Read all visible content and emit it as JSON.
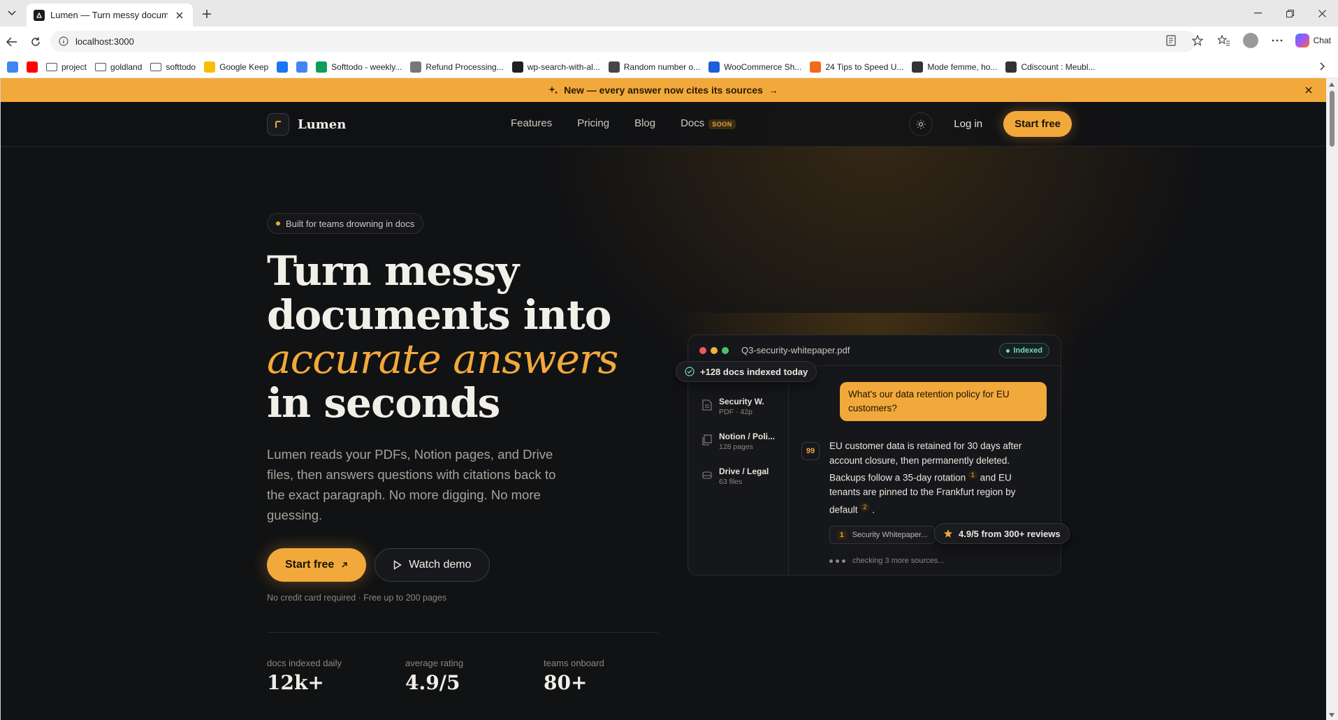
{
  "browser": {
    "tab_title": "Lumen — Turn messy documents into accurate answers",
    "url": "localhost:3000",
    "copilot_label": "Chat",
    "bookmarks": [
      {
        "label": "",
        "icon": "google-icon",
        "color": "#4285f4"
      },
      {
        "label": "",
        "icon": "youtube-icon",
        "color": "#ff0000"
      },
      {
        "label": "project",
        "icon": "folder-icon"
      },
      {
        "label": "goldland",
        "icon": "folder-icon"
      },
      {
        "label": "softtodo",
        "icon": "folder-icon"
      },
      {
        "label": "Google Keep",
        "icon": "keep-icon",
        "color": "#fbbc04"
      },
      {
        "label": "",
        "icon": "facebook-icon",
        "color": "#1877f2"
      },
      {
        "label": "",
        "icon": "translate-icon",
        "color": "#4285f4"
      },
      {
        "label": "Softtodo - weekly...",
        "icon": "sheets-icon",
        "color": "#0f9d58"
      },
      {
        "label": "Refund Processing...",
        "icon": "generic-icon",
        "color": "#777777"
      },
      {
        "label": "wp-search-with-al...",
        "icon": "github-icon",
        "color": "#1f1f1f"
      },
      {
        "label": "Random number o...",
        "icon": "wordpress-icon",
        "color": "#464646"
      },
      {
        "label": "WooCommerce Sh...",
        "icon": "woo-icon",
        "color": "#1f5fd9"
      },
      {
        "label": "24 Tips to Speed U...",
        "icon": "speed-icon",
        "color": "#f06a1d"
      },
      {
        "label": "Mode femme, ho...",
        "icon": "r-icon",
        "color": "#333333"
      },
      {
        "label": "Cdiscount : Meubl...",
        "icon": "cdiscount-icon",
        "color": "#333333"
      }
    ]
  },
  "announcement": {
    "text": "New — every answer now cites its sources",
    "arrow": "→"
  },
  "nav": {
    "brand": "Lumen",
    "links": [
      "Features",
      "Pricing",
      "Blog",
      "Docs"
    ],
    "docs_badge": "SOON",
    "login": "Log in",
    "cta": "Start free"
  },
  "hero": {
    "pill": "Built for teams drowning in docs",
    "title_line1": "Turn messy",
    "title_line2": "documents into",
    "title_accent": "accurate answers",
    "title_line4": "in seconds",
    "lede": "Lumen reads your PDFs, Notion pages, and Drive files, then answers questions with citations back to the exact paragraph. No more digging. No more guessing.",
    "cta_primary": "Start free",
    "cta_secondary": "Watch demo",
    "fine_print": "No credit card required · Free up to 200 pages"
  },
  "stats": [
    {
      "label": "docs indexed daily",
      "value": "12k+"
    },
    {
      "label": "average rating",
      "value": "4.9/5"
    },
    {
      "label": "teams onboard",
      "value": "80+"
    }
  ],
  "mock": {
    "file_name": "Q3-security-whitepaper.pdf",
    "status": "Indexed",
    "sources": [
      {
        "title": "Security W.",
        "sub": "PDF · 42p"
      },
      {
        "title": "Notion / Poli...",
        "sub": "128 pages"
      },
      {
        "title": "Drive / Legal",
        "sub": "63 files"
      }
    ],
    "question": "What's our data retention policy for EU customers?",
    "answer_part1": "EU customer data is retained for 30 days after account closure, then permanently deleted. Backups follow a 35-day rotation",
    "cite1": "1",
    "answer_part2": "and EU tenants are pinned to the Frankfurt region by default",
    "cite2": "2",
    "answer_end": ".",
    "chip1_num": "1",
    "chip1_label": "Security Whitepaper...",
    "typing": "checking 3 more sources...",
    "badge_docs": "+128 docs indexed today",
    "badge_rating": "4.9/5 from 300+ reviews"
  },
  "colors": {
    "accent": "#f2a93b",
    "background": "#111214",
    "indexed": "#7fd3bd"
  }
}
